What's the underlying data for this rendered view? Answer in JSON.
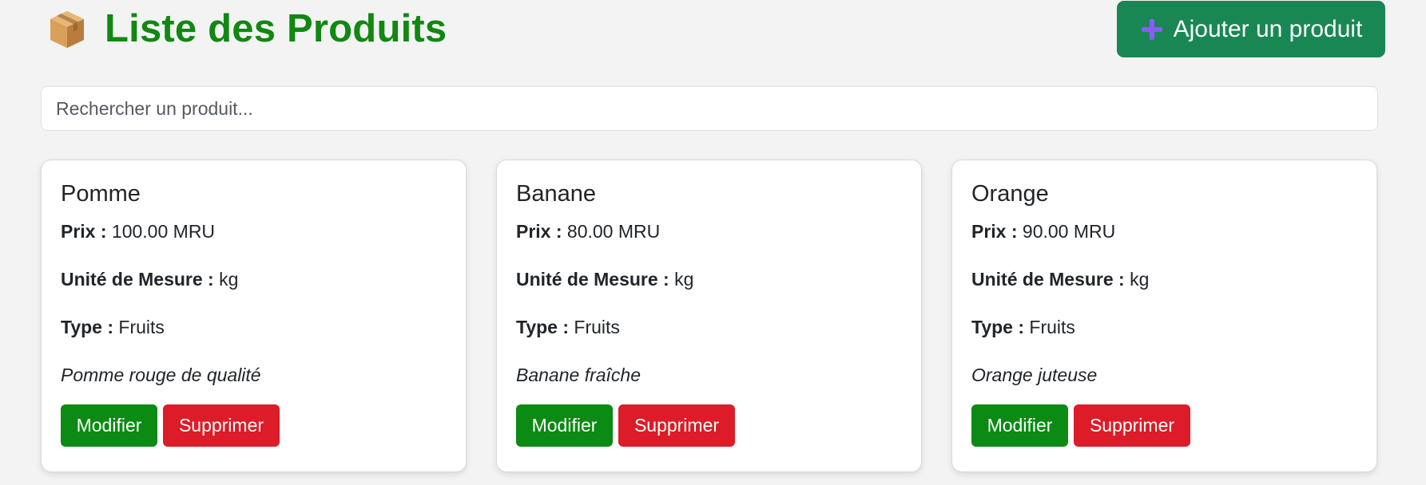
{
  "header": {
    "title": "Liste des Produits",
    "icon": "package-box-icon",
    "add_button_label": "Ajouter un produit",
    "add_button_icon": "plus-icon"
  },
  "search": {
    "placeholder": "Rechercher un produit...",
    "value": ""
  },
  "labels": {
    "price": "Prix :",
    "unit": "Unité de Mesure :",
    "type": "Type :",
    "edit": "Modifier",
    "delete": "Supprimer"
  },
  "products": [
    {
      "name": "Pomme",
      "price": "100.00 MRU",
      "unit": "kg",
      "type": "Fruits",
      "description": "Pomme rouge de qualité"
    },
    {
      "name": "Banane",
      "price": "80.00 MRU",
      "unit": "kg",
      "type": "Fruits",
      "description": "Banane fraîche"
    },
    {
      "name": "Orange",
      "price": "90.00 MRU",
      "unit": "kg",
      "type": "Fruits",
      "description": "Orange juteuse"
    }
  ],
  "colors": {
    "title": "#118811",
    "add_button": "#198754",
    "edit_button": "#0b8a14",
    "delete_button": "#dc1c28",
    "plus_icon": "#8a5cf5",
    "background": "#f3f3f3"
  }
}
